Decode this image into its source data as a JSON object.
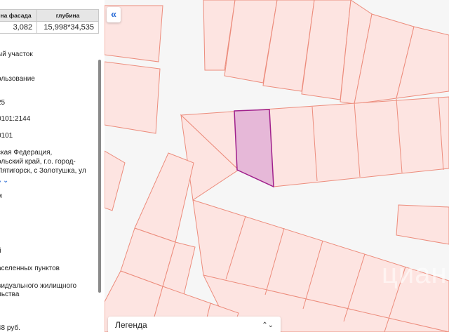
{
  "panel": {
    "table": {
      "headers": [
        "на фасада",
        "глубина"
      ],
      "values": [
        "3,082",
        "15,998*34,535"
      ]
    },
    "rows": [
      {
        "text": "ый участок"
      },
      {
        "text": "ользование"
      },
      {
        "text": "25"
      },
      {
        "text": "0101:2144"
      },
      {
        "text": "0101"
      },
      {
        "text": "ская Федерация,"
      },
      {
        "text": "ольский край, г.о. город-"
      },
      {
        "text": "Пятигорск, с Золотушка, ул"
      },
      {
        "text": "ь ⌄"
      },
      {
        "text": "м"
      },
      {
        "text": "й"
      },
      {
        "text": "аселенных пунктов"
      },
      {
        "text": "видуального жилищного"
      },
      {
        "text": "льства"
      },
      {
        "text": "48 руб."
      }
    ]
  },
  "map": {
    "collapse_icon": "«",
    "legend_label": "Легенда",
    "legend_chevron": "⌃⌄",
    "watermark": "циан",
    "colors": {
      "parcel_fill": "#fde4e1",
      "parcel_stroke": "#ec8c7c",
      "selected_fill": "#e6b8d8",
      "selected_stroke": "#a0208c",
      "road": "#f6f6f6"
    }
  }
}
